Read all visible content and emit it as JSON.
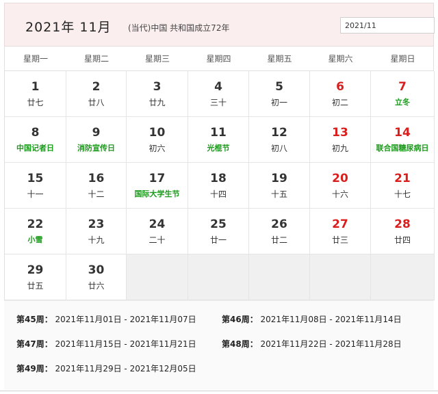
{
  "header": {
    "title": "2021年  11月",
    "subtitle": "(当代)中国 共和国成立72年",
    "date_value": "2021/11"
  },
  "weekdays": [
    "星期一",
    "星期二",
    "星期三",
    "星期四",
    "星期五",
    "星期六",
    "星期日"
  ],
  "days": [
    {
      "d": "1",
      "l": "廿七"
    },
    {
      "d": "2",
      "l": "廿八"
    },
    {
      "d": "3",
      "l": "廿九"
    },
    {
      "d": "4",
      "l": "三十"
    },
    {
      "d": "5",
      "l": "初一"
    },
    {
      "d": "6",
      "l": "初二"
    },
    {
      "d": "7",
      "l": "立冬"
    },
    {
      "d": "8",
      "l": "中国记者日"
    },
    {
      "d": "9",
      "l": "消防宣传日"
    },
    {
      "d": "10",
      "l": "初六"
    },
    {
      "d": "11",
      "l": "光棍节"
    },
    {
      "d": "12",
      "l": "初八"
    },
    {
      "d": "13",
      "l": "初九"
    },
    {
      "d": "14",
      "l": "联合国糖尿病日"
    },
    {
      "d": "15",
      "l": "十一"
    },
    {
      "d": "16",
      "l": "十二"
    },
    {
      "d": "17",
      "l": "国际大学生节"
    },
    {
      "d": "18",
      "l": "十四"
    },
    {
      "d": "19",
      "l": "十五"
    },
    {
      "d": "20",
      "l": "十六"
    },
    {
      "d": "21",
      "l": "十七"
    },
    {
      "d": "22",
      "l": "小雪"
    },
    {
      "d": "23",
      "l": "十九"
    },
    {
      "d": "24",
      "l": "二十"
    },
    {
      "d": "25",
      "l": "廿一"
    },
    {
      "d": "26",
      "l": "廿二"
    },
    {
      "d": "27",
      "l": "廿三"
    },
    {
      "d": "28",
      "l": "廿四"
    },
    {
      "d": "29",
      "l": "廿五"
    },
    {
      "d": "30",
      "l": "廿六"
    }
  ],
  "weeks": [
    {
      "label": "第45周：",
      "range": "2021年11月01日 - 2021年11月07日"
    },
    {
      "label": "第46周：",
      "range": "2021年11月08日 - 2021年11月14日"
    },
    {
      "label": "第47周：",
      "range": "2021年11月15日 - 2021年11月21日"
    },
    {
      "label": "第48周：",
      "range": "2021年11月22日 - 2021年11月28日"
    },
    {
      "label": "第49周：",
      "range": "2021年11月29日 - 2021年12月05日"
    }
  ],
  "colors": {
    "weekend": "#d91e1e",
    "festival": "#1a9a1a",
    "header_bg": "#fbeeee"
  }
}
